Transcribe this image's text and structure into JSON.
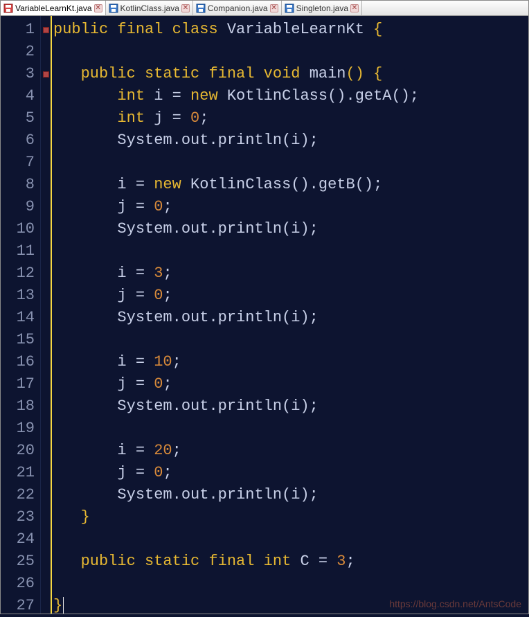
{
  "tabs": [
    {
      "label": "VariableLearnKt.java",
      "active": true,
      "icon": "save-red"
    },
    {
      "label": "KotlinClass.java",
      "active": false,
      "icon": "save-blue"
    },
    {
      "label": "Companion.java",
      "active": false,
      "icon": "save-blue"
    },
    {
      "label": "Singleton.java",
      "active": false,
      "icon": "save-blue"
    }
  ],
  "line_numbers": [
    "1",
    "2",
    "3",
    "4",
    "5",
    "6",
    "7",
    "8",
    "9",
    "10",
    "11",
    "12",
    "13",
    "14",
    "15",
    "16",
    "17",
    "18",
    "19",
    "20",
    "21",
    "22",
    "23",
    "24",
    "25",
    "26",
    "27"
  ],
  "code": {
    "l1": {
      "kw1": "public",
      "kw2": "final",
      "kw3": "class",
      "name": "VariableLearnKt",
      "br": "{"
    },
    "l3": {
      "kw1": "public",
      "kw2": "static",
      "kw3": "final",
      "kw4": "void",
      "name": "main",
      "par": "() {"
    },
    "l4": {
      "ty": "int",
      "v": "i",
      "eq": "=",
      "kw": "new",
      "cls": "KotlinClass",
      "call": "().getA();"
    },
    "l5": {
      "ty": "int",
      "v": "j",
      "eq": "=",
      "n": "0",
      "semi": ";"
    },
    "l6": {
      "stmt": "System.out.println(i);"
    },
    "l8": {
      "v": "i",
      "eq": "=",
      "kw": "new",
      "cls": "KotlinClass",
      "call": "().getB();"
    },
    "l9": {
      "v": "j",
      "eq": "=",
      "n": "0",
      "semi": ";"
    },
    "l10": {
      "stmt": "System.out.println(i);"
    },
    "l12": {
      "v": "i",
      "eq": "=",
      "n": "3",
      "semi": ";"
    },
    "l13": {
      "v": "j",
      "eq": "=",
      "n": "0",
      "semi": ";"
    },
    "l14": {
      "stmt": "System.out.println(i);"
    },
    "l16": {
      "v": "i",
      "eq": "=",
      "n": "10",
      "semi": ";"
    },
    "l17": {
      "v": "j",
      "eq": "=",
      "n": "0",
      "semi": ";"
    },
    "l18": {
      "stmt": "System.out.println(i);"
    },
    "l20": {
      "v": "i",
      "eq": "=",
      "n": "20",
      "semi": ";"
    },
    "l21": {
      "v": "j",
      "eq": "=",
      "n": "0",
      "semi": ";"
    },
    "l22": {
      "stmt": "System.out.println(i);"
    },
    "l23": {
      "br": "}"
    },
    "l25": {
      "kw1": "public",
      "kw2": "static",
      "kw3": "final",
      "kw4": "int",
      "name": "C",
      "eq": "=",
      "n": "3",
      "semi": ";"
    },
    "l27": {
      "br": "}"
    }
  },
  "watermark": "https://blog.csdn.net/AntsCode"
}
